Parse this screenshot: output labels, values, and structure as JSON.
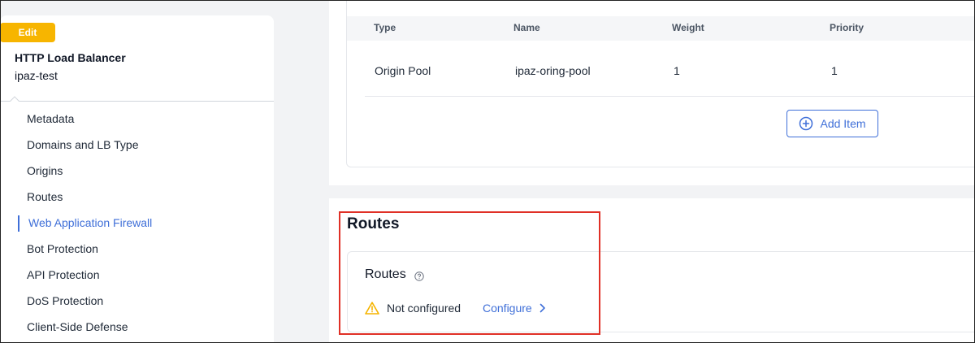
{
  "sidebar": {
    "edit_label": "Edit",
    "object_type": "HTTP Load Balancer",
    "object_name": "ipaz-test",
    "items": [
      {
        "label": "Metadata"
      },
      {
        "label": "Domains and LB Type"
      },
      {
        "label": "Origins"
      },
      {
        "label": "Routes"
      },
      {
        "label": "Web Application Firewall",
        "active": true
      },
      {
        "label": "Bot Protection"
      },
      {
        "label": "API Protection"
      },
      {
        "label": "DoS Protection"
      },
      {
        "label": "Client-Side Defense"
      }
    ]
  },
  "origin_table": {
    "columns": [
      "Type",
      "Name",
      "Weight",
      "Priority"
    ],
    "rows": [
      [
        "Origin Pool",
        "ipaz-oring-pool",
        "1",
        "1"
      ]
    ],
    "add_label": "Add Item"
  },
  "routes_section": {
    "title": "Routes",
    "field_label": "Routes",
    "status": "Not configured",
    "configure_label": "Configure"
  },
  "colors": {
    "accent": "#3f6fd8",
    "edit_badge": "#f7b500",
    "warning": "#f5b400",
    "highlight": "#e03026"
  },
  "icons": [
    "plus-circle-icon",
    "help-circle-icon",
    "warning-triangle-icon",
    "chevron-right-icon"
  ]
}
